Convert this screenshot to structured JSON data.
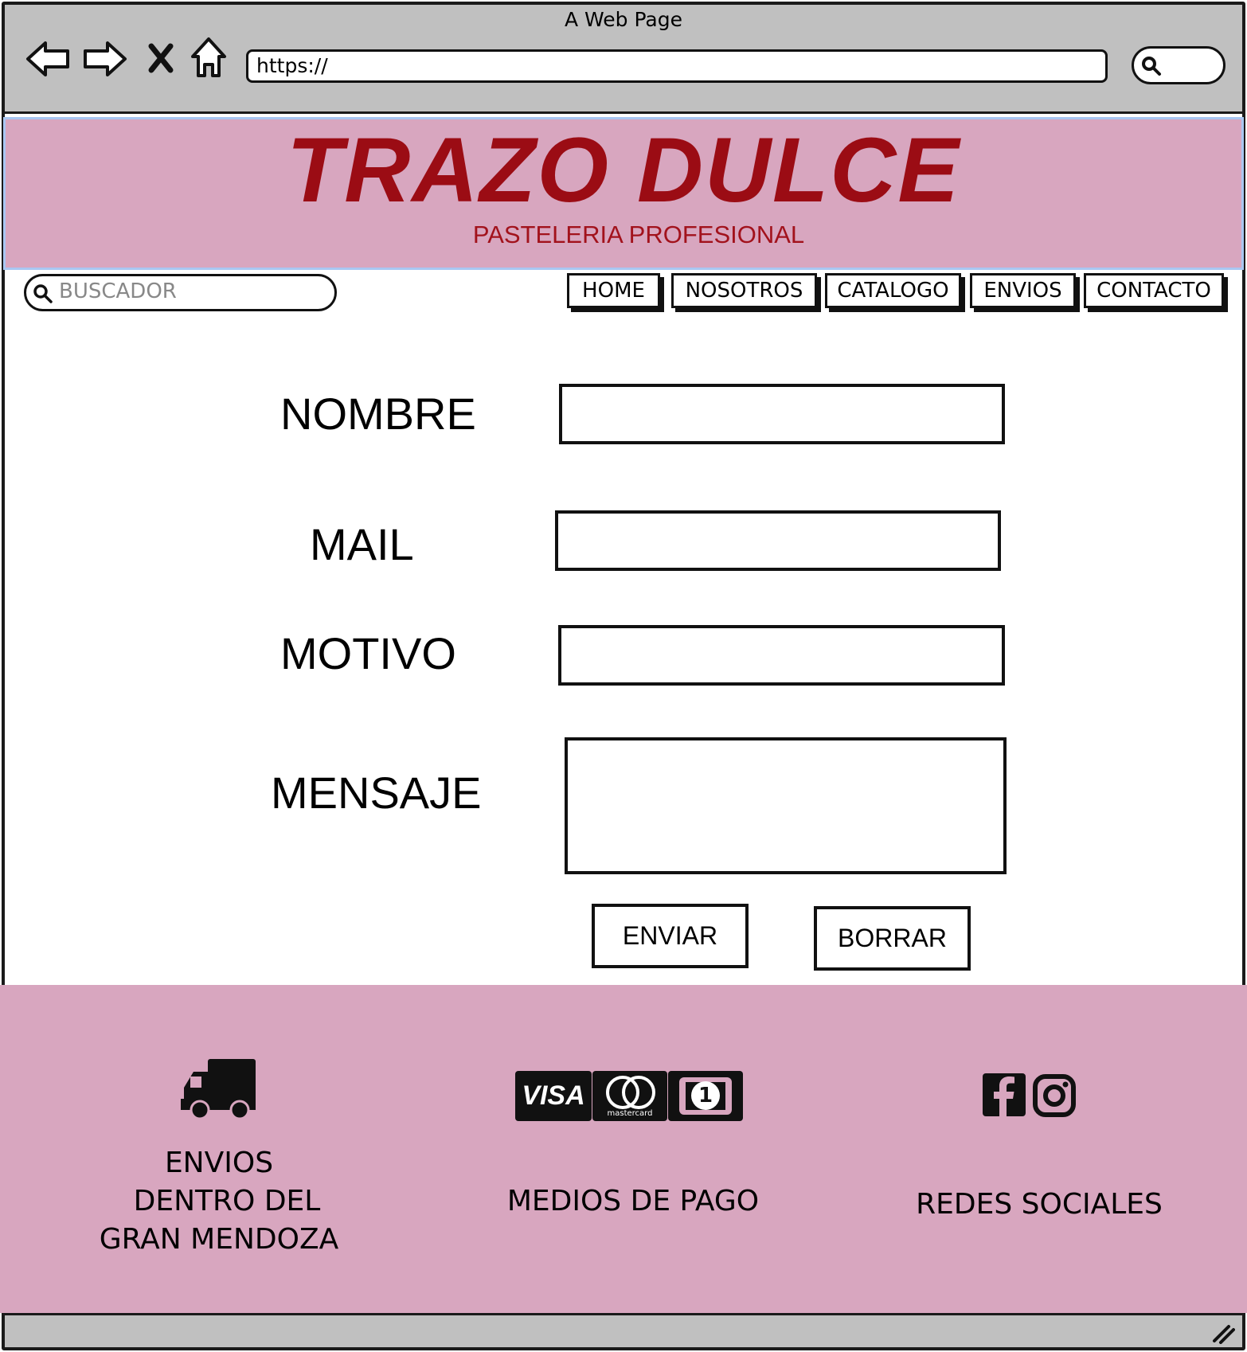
{
  "browser": {
    "window_title": "A Web Page",
    "url": "https://"
  },
  "header": {
    "brand_title": "TRAZO DULCE",
    "brand_subtitle": "PASTELERIA PROFESIONAL"
  },
  "site_search": {
    "placeholder": "BUSCADOR"
  },
  "nav": {
    "items": [
      {
        "label": "HOME"
      },
      {
        "label": "NOSOTROS"
      },
      {
        "label": "CATALOGO"
      },
      {
        "label": "ENVIOS"
      },
      {
        "label": "CONTACTO"
      }
    ]
  },
  "form": {
    "fields": [
      {
        "label": "NOMBRE",
        "value": ""
      },
      {
        "label": "MAIL",
        "value": ""
      },
      {
        "label": "MOTIVO",
        "value": ""
      },
      {
        "label": "MENSAJE",
        "value": ""
      }
    ],
    "submit_label": "ENVIAR",
    "reset_label": "BORRAR"
  },
  "footer": {
    "shipping": {
      "line1": "ENVIOS",
      "line2": "DENTRO DEL",
      "line3": "GRAN MENDOZA",
      "icon": "truck-icon"
    },
    "payments": {
      "title": "MEDIOS DE PAGO",
      "visa_text": "VISA",
      "mastercard_text": "mastercard",
      "cash_text": "1"
    },
    "social": {
      "title": "REDES SOCIALES",
      "icons": [
        "facebook-icon",
        "instagram-icon"
      ]
    }
  },
  "colors": {
    "banner_bg": "#d8a6bf",
    "brand_red": "#9b0c14",
    "chrome_gray": "#c0c0c0"
  }
}
